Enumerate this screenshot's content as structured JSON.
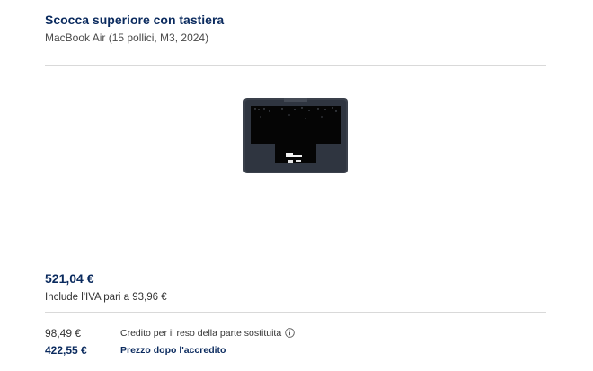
{
  "product": {
    "title": "Scocca superiore con tastiera",
    "subtitle": "MacBook Air (15 pollici, M3, 2024)"
  },
  "pricing": {
    "price": "521,04 €",
    "vat_note": "Include l'IVA pari a 93,96 €",
    "credit_amount": "98,49 €",
    "credit_label": "Credito per il reso della parte sostituita",
    "net_amount": "422,55 €",
    "net_label": "Prezzo dopo l'accredito"
  },
  "icons": {
    "info": "info-circle-icon"
  },
  "colors": {
    "accent": "#0a2a5e",
    "divider": "#d9d9d9",
    "product_body": "#2f3540"
  }
}
